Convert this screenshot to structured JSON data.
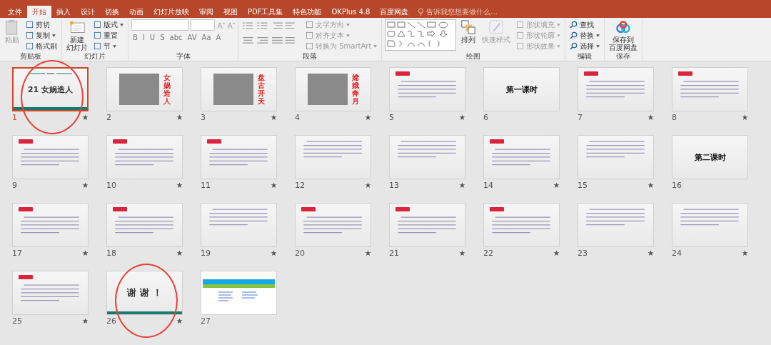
{
  "tabs": [
    {
      "label": "文件",
      "selected": false
    },
    {
      "label": "开始",
      "selected": true
    },
    {
      "label": "插入",
      "selected": false
    },
    {
      "label": "设计",
      "selected": false
    },
    {
      "label": "切换",
      "selected": false
    },
    {
      "label": "动画",
      "selected": false
    },
    {
      "label": "幻灯片放映",
      "selected": false
    },
    {
      "label": "审阅",
      "selected": false
    },
    {
      "label": "视图",
      "selected": false
    },
    {
      "label": "PDF工具集",
      "selected": false
    },
    {
      "label": "特色功能",
      "selected": false
    },
    {
      "label": "OKPlus 4.8",
      "selected": false
    },
    {
      "label": "百度网盘",
      "selected": false
    }
  ],
  "tell_me": {
    "placeholder": "告诉我您想要做什么..."
  },
  "ribbon": {
    "clipboard": {
      "label": "剪贴板",
      "paste": {
        "label": "粘贴",
        "disabled": true
      },
      "tools": [
        {
          "label": "剪切",
          "dropdown": false,
          "disabled": false
        },
        {
          "label": "复制",
          "dropdown": true,
          "disabled": false
        },
        {
          "label": "格式刷",
          "dropdown": false,
          "disabled": false
        }
      ]
    },
    "slides": {
      "label": "幻灯片",
      "new_slide": {
        "label_lines": [
          "新建",
          "幻灯片"
        ]
      },
      "tools": [
        {
          "label": "版式",
          "dropdown": true,
          "disabled": false
        },
        {
          "label": "重置",
          "dropdown": false,
          "disabled": false
        },
        {
          "label": "节",
          "dropdown": true,
          "disabled": false
        }
      ]
    },
    "font": {
      "label": "字体",
      "format_buttons": [
        "B",
        "I",
        "U",
        "S",
        "abc",
        "AV",
        "Aa",
        "A"
      ]
    },
    "paragraph": {
      "label": "段落",
      "tools": [
        {
          "label": "文字方向",
          "dropdown": true,
          "disabled": true
        },
        {
          "label": "对齐文本",
          "dropdown": true,
          "disabled": true
        },
        {
          "label": "转换为 SmartArt",
          "dropdown": true,
          "disabled": true
        }
      ]
    },
    "drawing": {
      "label": "绘图",
      "arrange": {
        "label": "排列"
      },
      "quick_styles": {
        "label": "快速样式",
        "disabled": true
      },
      "tools": [
        {
          "label": "形状填充",
          "dropdown": true,
          "disabled": true
        },
        {
          "label": "形状轮廓",
          "dropdown": true,
          "disabled": true
        },
        {
          "label": "形状效果",
          "dropdown": true,
          "disabled": true
        }
      ]
    },
    "editing": {
      "label": "编辑",
      "tools": [
        {
          "label": "查找",
          "dropdown": false,
          "disabled": false
        },
        {
          "label": "替换",
          "dropdown": true,
          "disabled": false
        },
        {
          "label": "选择",
          "dropdown": true,
          "disabled": false
        }
      ]
    },
    "save": {
      "label": "保存",
      "button": {
        "label_lines": [
          "保存到",
          "百度网盘"
        ]
      }
    }
  },
  "slides": [
    {
      "number": "1",
      "kind": "title",
      "title": "21 女娲造人",
      "selected": true,
      "transition": true,
      "circled": true
    },
    {
      "number": "2",
      "kind": "picture",
      "title": "女娲造人",
      "selected": false,
      "transition": true,
      "circled": false
    },
    {
      "number": "3",
      "kind": "picture",
      "title": "盘古开天",
      "selected": false,
      "transition": true,
      "circled": false
    },
    {
      "number": "4",
      "kind": "picture",
      "title": "嫦娥奔月",
      "selected": false,
      "transition": true,
      "circled": false
    },
    {
      "number": "5",
      "kind": "text",
      "badge": true,
      "selected": false,
      "transition": true,
      "circled": false
    },
    {
      "number": "6",
      "kind": "heading",
      "title": "第一课时",
      "selected": false,
      "transition": false,
      "circled": false
    },
    {
      "number": "7",
      "kind": "text",
      "badge": true,
      "selected": false,
      "transition": true,
      "circled": false
    },
    {
      "number": "8",
      "kind": "text",
      "badge": true,
      "selected": false,
      "transition": true,
      "circled": false
    },
    {
      "number": "9",
      "kind": "text",
      "badge": true,
      "selected": false,
      "transition": true,
      "circled": false
    },
    {
      "number": "10",
      "kind": "text",
      "badge": true,
      "selected": false,
      "transition": true,
      "circled": false
    },
    {
      "number": "11",
      "kind": "text",
      "badge": true,
      "selected": false,
      "transition": true,
      "circled": false
    },
    {
      "number": "12",
      "kind": "text",
      "badge": false,
      "selected": false,
      "transition": true,
      "circled": false
    },
    {
      "number": "13",
      "kind": "text",
      "badge": false,
      "selected": false,
      "transition": true,
      "circled": false
    },
    {
      "number": "14",
      "kind": "text",
      "badge": true,
      "selected": false,
      "transition": true,
      "circled": false
    },
    {
      "number": "15",
      "kind": "text",
      "badge": false,
      "selected": false,
      "transition": true,
      "circled": false
    },
    {
      "number": "16",
      "kind": "heading",
      "title": "第二课时",
      "selected": false,
      "transition": false,
      "circled": false
    },
    {
      "number": "17",
      "kind": "text",
      "badge": true,
      "selected": false,
      "transition": true,
      "circled": false
    },
    {
      "number": "18",
      "kind": "text",
      "badge": true,
      "selected": false,
      "transition": true,
      "circled": false
    },
    {
      "number": "19",
      "kind": "text",
      "badge": false,
      "selected": false,
      "transition": true,
      "circled": false
    },
    {
      "number": "20",
      "kind": "text",
      "badge": true,
      "selected": false,
      "transition": true,
      "circled": false
    },
    {
      "number": "21",
      "kind": "text",
      "badge": true,
      "selected": false,
      "transition": true,
      "circled": false
    },
    {
      "number": "22",
      "kind": "text",
      "badge": true,
      "selected": false,
      "transition": true,
      "circled": false
    },
    {
      "number": "23",
      "kind": "text",
      "badge": false,
      "selected": false,
      "transition": true,
      "circled": false
    },
    {
      "number": "24",
      "kind": "text",
      "badge": false,
      "selected": false,
      "transition": true,
      "circled": false
    },
    {
      "number": "25",
      "kind": "text",
      "badge": true,
      "selected": false,
      "transition": true,
      "circled": false
    },
    {
      "number": "26",
      "kind": "thanks",
      "title": "谢 谢 ！",
      "selected": false,
      "transition": true,
      "circled": true
    },
    {
      "number": "27",
      "kind": "web",
      "selected": false,
      "transition": false,
      "circled": false
    }
  ]
}
